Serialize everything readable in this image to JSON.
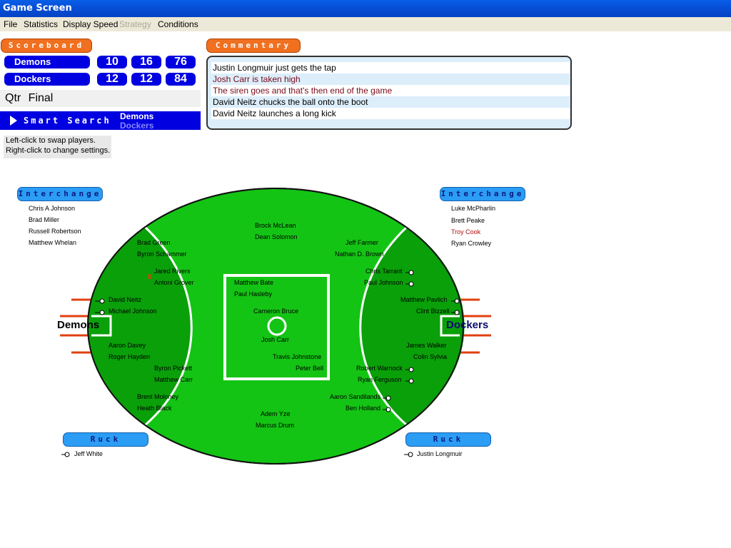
{
  "window": {
    "title": "Game Screen"
  },
  "menu": {
    "file": "File",
    "statistics": "Statistics",
    "display_speed": "Display Speed",
    "strategy": "Strategy",
    "conditions": "Conditions"
  },
  "scoreboard": {
    "header": "Scoreboard",
    "teams": [
      {
        "name": "Demons",
        "goals": "10",
        "behinds": "16",
        "total": "76"
      },
      {
        "name": "Dockers",
        "goals": "12",
        "behinds": "12",
        "total": "84"
      }
    ],
    "qtr_label": "Qtr",
    "qtr_value": "Final"
  },
  "smart_search": {
    "label": "Smart Search",
    "team1": "Demons",
    "team2": "Dockers"
  },
  "hint": {
    "line1": "Left-click to swap players.",
    "line2": "Right-click to change settings."
  },
  "commentary": {
    "header": "Commentary",
    "lines": [
      {
        "text": "Justin Longmuir just gets the tap",
        "color": "#000000"
      },
      {
        "text": "Josh Carr is taken high",
        "color": "#7a0a1a"
      },
      {
        "text": "The siren goes and that's then end of the game",
        "color": "#7a0a1a"
      },
      {
        "text": "David Neitz chucks the ball onto the boot",
        "color": "#000000"
      },
      {
        "text": "David Neitz launches a long kick",
        "color": "#000000"
      }
    ]
  },
  "interchange": {
    "header": "Interchange",
    "left": [
      "Chris A Johnson",
      "Brad Miller",
      "Russell Robertson",
      "Matthew Whelan"
    ],
    "right": [
      "Luke McPharlin",
      "Brett Peake",
      "Troy Cook",
      "Ryan Crowley"
    ]
  },
  "ruck": {
    "header": "Ruck",
    "left": "Jeff White",
    "right": "Justin Longmuir"
  },
  "field": {
    "left_team": "Demons",
    "right_team": "Dockers",
    "players": {
      "brock_mclean": "Brock McLean",
      "dean_solomon": "Dean Solomon",
      "brad_green": "Brad Green",
      "byron_schammer": "Byron Schammer",
      "jeff_farmer": "Jeff Farmer",
      "nathan_brown": "Nathan D. Brown",
      "jared_rivers": "Jared Rivers",
      "antoni_grover": "Antoni Grover",
      "chris_tarrant": "Chris Tarrant",
      "paul_johnson": "Paul Johnson",
      "matthew_bate": "Matthew Bate",
      "paul_hasleby": "Paul Hasleby",
      "david_neitz": "David Neitz",
      "michael_johnson": "Michael Johnson",
      "matthew_pavlich": "Matthew Pavlich",
      "clint_bizzell": "Clint Bizzell",
      "cameron_bruce": "Cameron Bruce",
      "josh_carr": "Josh Carr",
      "aaron_davey": "Aaron Davey",
      "roger_hayden": "Roger Hayden",
      "james_walker": "James Walker",
      "colin_sylvia": "Colin Sylvia",
      "travis_johnstone": "Travis Johnstone",
      "peter_bell": "Peter Bell",
      "byron_pickett": "Byron Pickett",
      "matthew_carr": "Matthew Carr",
      "robert_warnock": "Robert Warnock",
      "ryan_ferguson": "Ryan Ferguson",
      "brent_moloney": "Brent Moloney",
      "heath_black": "Heath Black",
      "aaron_sandilands": "Aaron Sandilands",
      "ben_holland": "Ben Holland",
      "adem_yze": "Adem Yze",
      "marcus_drum": "Marcus Drum"
    }
  },
  "colors": {
    "field": "#14c414",
    "field_dark": "#0aa00a",
    "team_box": "#0000e0",
    "orange": "#f07020",
    "posts": "#e04010"
  }
}
